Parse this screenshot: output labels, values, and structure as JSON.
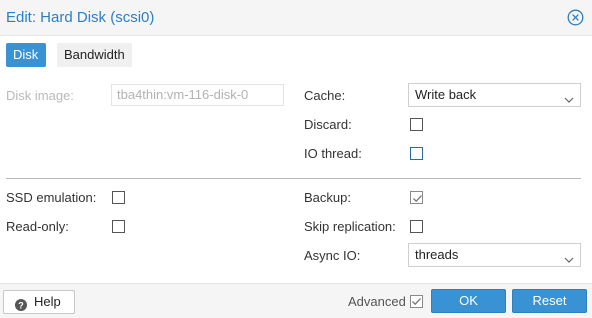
{
  "dialog": {
    "title": "Edit: Hard Disk (scsi0)"
  },
  "tabs": [
    {
      "label": "Disk",
      "active": true
    },
    {
      "label": "Bandwidth",
      "active": false
    }
  ],
  "form": {
    "disk_image": {
      "label": "Disk image:",
      "value": "tba4thin:vm-116-disk-0",
      "disabled": true
    },
    "cache": {
      "label": "Cache:",
      "value": "Write back"
    },
    "discard": {
      "label": "Discard:",
      "checked": false
    },
    "io_thread": {
      "label": "IO thread:",
      "checked": false
    },
    "ssd_emulation": {
      "label": "SSD emulation:",
      "checked": false
    },
    "read_only": {
      "label": "Read-only:",
      "checked": false
    },
    "backup": {
      "label": "Backup:",
      "checked": true
    },
    "skip_replication": {
      "label": "Skip replication:",
      "checked": false
    },
    "async_io": {
      "label": "Async IO:",
      "value": "threads"
    }
  },
  "footer": {
    "help_label": "Help",
    "advanced_label": "Advanced",
    "advanced_checked": true,
    "ok_label": "OK",
    "reset_label": "Reset"
  },
  "colors": {
    "accent": "#3892d4",
    "title": "#2b7ec8"
  },
  "icons": {
    "close": "close-icon",
    "help": "help-icon",
    "dropdown": "chevron-down-icon",
    "check": "checkmark-icon"
  }
}
